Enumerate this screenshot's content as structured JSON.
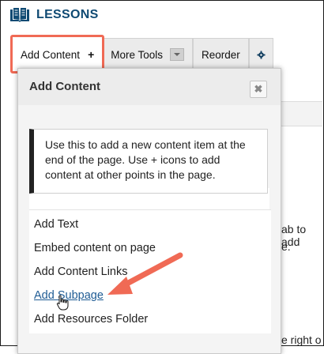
{
  "header": {
    "title": "LESSONS",
    "icon": "book-icon"
  },
  "toolbar": {
    "add_content_label": "Add Content",
    "add_content_plus": "+",
    "more_tools_label": "More Tools",
    "reorder_label": "Reorder",
    "settings_icon": "gear-icon",
    "highlight_color": "#f06a55"
  },
  "background_text": {
    "line1": "ab to add",
    "line2": "e.",
    "line3": "e right o"
  },
  "panel": {
    "title": "Add Content",
    "close_glyph": "✖",
    "info": "Use this to add a new content item at the end of the page. Use + icons to add content at other points in the page.",
    "items": [
      {
        "label": "Add Text"
      },
      {
        "label": "Embed content on page"
      },
      {
        "label": "Add Content Links"
      },
      {
        "label": "Add Subpage"
      },
      {
        "label": "Add Resources Folder"
      }
    ]
  },
  "annotation": {
    "arrow_color": "#f06a55"
  }
}
